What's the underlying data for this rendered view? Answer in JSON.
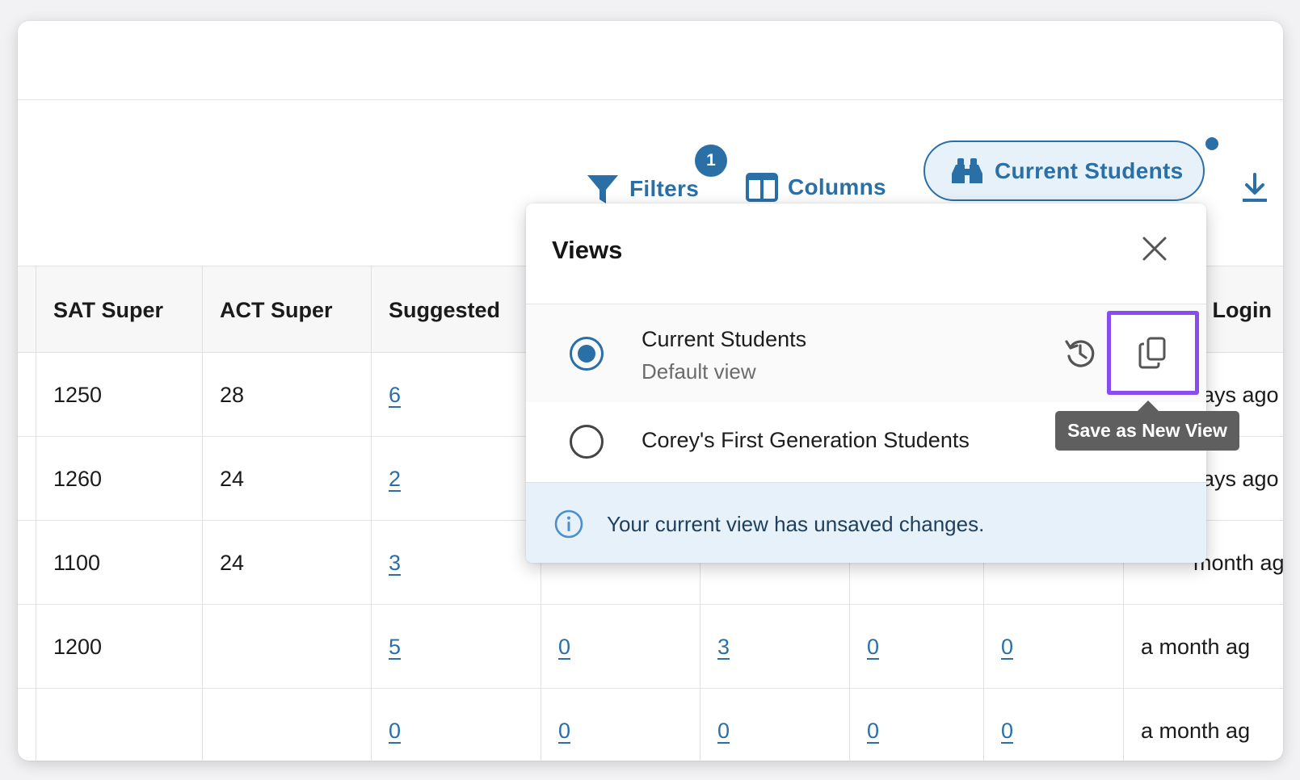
{
  "toolbar": {
    "filters_label": "Filters",
    "filters_count": "1",
    "columns_label": "Columns",
    "views_label": "Current Students",
    "download_icon": "download-icon"
  },
  "table": {
    "headers": [
      "SAT Super",
      "ACT Super",
      "Suggested",
      "",
      "",
      "",
      "",
      "t Login"
    ],
    "rows": [
      {
        "sat": "1250",
        "act": "28",
        "suggested": "6",
        "c4": "",
        "c5": "",
        "c6": "",
        "c7": "",
        "last_login": "ays ago"
      },
      {
        "sat": "1260",
        "act": "24",
        "suggested": "2",
        "c4": "",
        "c5": "",
        "c6": "",
        "c7": "",
        "last_login": "ays ago"
      },
      {
        "sat": "1100",
        "act": "24",
        "suggested": "3",
        "c4": "",
        "c5": "",
        "c6": "",
        "c7": "",
        "last_login": "month ag"
      },
      {
        "sat": "1200",
        "act": "",
        "suggested": "5",
        "c4": "0",
        "c5": "3",
        "c6": "0",
        "c7": "0",
        "last_login": "a month ag"
      },
      {
        "sat": "",
        "act": "",
        "suggested": "0",
        "c4": "0",
        "c5": "0",
        "c6": "0",
        "c7": "0",
        "last_login": "a month ag"
      }
    ]
  },
  "views_popover": {
    "title": "Views",
    "items": [
      {
        "name": "Current Students",
        "subtitle": "Default view",
        "selected": true
      },
      {
        "name": "Corey's First Generation Students",
        "selected": false
      }
    ],
    "info_message": "Your current view has unsaved changes.",
    "tooltip": "Save as New View"
  },
  "colors": {
    "accent": "#2a6fa6",
    "highlight": "#8a4cf0",
    "info_bg": "#e7f1fa",
    "tooltip_bg": "#5f5f5f"
  }
}
